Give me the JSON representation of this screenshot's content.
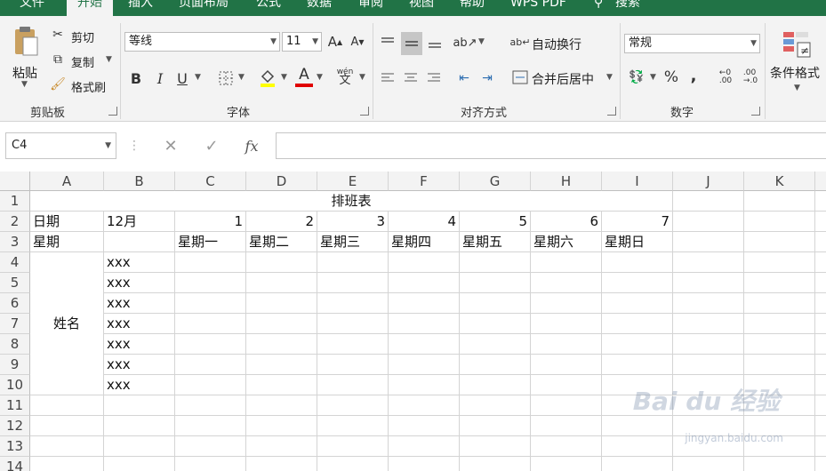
{
  "tabs": [
    "文件",
    "开始",
    "插入",
    "页面布局",
    "公式",
    "数据",
    "审阅",
    "视图",
    "帮助",
    "WPS PDF",
    "搜索"
  ],
  "clipboard": {
    "paste": "粘贴",
    "cut": "剪切",
    "copy": "复制",
    "format_painter": "格式刷",
    "label": "剪贴板"
  },
  "font": {
    "name": "等线",
    "size": "11",
    "label": "字体",
    "bold": "B",
    "italic": "I",
    "underline": "U",
    "color_letter": "A",
    "phonetic": "wén"
  },
  "alignment": {
    "wrap": "自动换行",
    "merge": "合并后居中",
    "label": "对齐方式"
  },
  "number": {
    "format": "常规",
    "label": "数字",
    "percent": "%",
    "comma": ","
  },
  "styles": {
    "conditional": "条件格式"
  },
  "formula_bar": {
    "name_box": "C4",
    "fx": "fx",
    "value": ""
  },
  "columns": [
    "A",
    "B",
    "C",
    "D",
    "E",
    "F",
    "G",
    "H",
    "I",
    "J",
    "K"
  ],
  "rows": [
    "1",
    "2",
    "3",
    "4",
    "5",
    "6",
    "7",
    "8",
    "9",
    "10",
    "11",
    "12",
    "13",
    "14"
  ],
  "sheet": {
    "title": "排班表",
    "a2": "日期",
    "b2": "12月",
    "days": [
      "1",
      "2",
      "3",
      "4",
      "5",
      "6",
      "7"
    ],
    "a3": "星期",
    "weekdays": [
      "星期一",
      "星期二",
      "星期三",
      "星期四",
      "星期五",
      "星期六",
      "星期日"
    ],
    "name_label": "姓名",
    "names": [
      "xxx",
      "xxx",
      "xxx",
      "xxx",
      "xxx",
      "xxx",
      "xxx"
    ]
  },
  "watermark": {
    "brand": "Bai du 经验",
    "url": "jingyan.baidu.com"
  },
  "colors": {
    "accent": "#217346",
    "ribbon": "#f3f3f3",
    "grid": "#d4d4d4"
  }
}
